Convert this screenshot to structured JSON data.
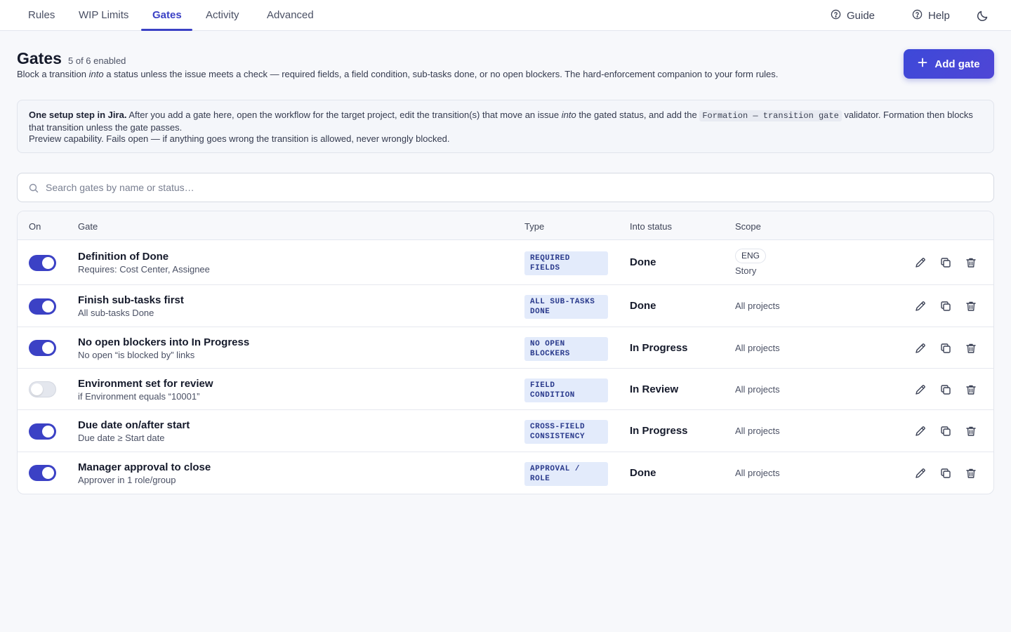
{
  "nav": {
    "tabs": [
      {
        "label": "Rules"
      },
      {
        "label": "WIP Limits"
      },
      {
        "label": "Gates"
      },
      {
        "label": "Activity"
      },
      {
        "label": "Advanced"
      }
    ],
    "active_tab": "Gates",
    "guide_label": "Guide",
    "help_label": "Help",
    "icons": {
      "guide": "help-circle-icon",
      "help": "help-circle-icon",
      "theme": "moon-icon"
    }
  },
  "header": {
    "title": "Gates",
    "count": "5 of 6 enabled",
    "desc_before": "Block a transition ",
    "desc_em": "into",
    "desc_after": " a status unless the issue meets a check — required fields, a field condition, sub-tasks done, or no open blockers. The hard-enforcement companion to your form rules.",
    "add_button": "Add gate",
    "add_icon": "plus-icon"
  },
  "info": {
    "bold": "One setup step in Jira.",
    "text1": " After you add a gate here, open the workflow for the target project, edit the transition(s) that move an issue ",
    "em": "into",
    "text2": " the gated status, and add the ",
    "code": "Formation — transition gate",
    "text3": " validator. Formation then blocks that transition unless the gate passes.",
    "line2": "Preview capability. Fails open — if anything goes wrong the transition is allowed, never wrongly blocked."
  },
  "search": {
    "placeholder": "Search gates by name or status…",
    "value": ""
  },
  "table": {
    "columns": {
      "on": "On",
      "gate": "Gate",
      "type": "Type",
      "status": "Into status",
      "scope": "Scope"
    },
    "rows": [
      {
        "enabled": true,
        "name": "Definition of Done",
        "sub": "Requires: Cost Center, Assignee",
        "type": "REQUIRED FIELDS",
        "status": "Done",
        "scope_pill": "ENG",
        "scope": "Story"
      },
      {
        "enabled": true,
        "name": "Finish sub-tasks first",
        "sub": "All sub-tasks Done",
        "type": "ALL SUB-TASKS DONE",
        "status": "Done",
        "scope_pill": "",
        "scope": "All projects"
      },
      {
        "enabled": true,
        "name": "No open blockers into In Progress",
        "sub": "No open “is blocked by” links",
        "type": "NO OPEN BLOCKERS",
        "status": "In Progress",
        "scope_pill": "",
        "scope": "All projects"
      },
      {
        "enabled": false,
        "name": "Environment set for review",
        "sub": "if Environment equals “10001”",
        "type": "FIELD CONDITION",
        "status": "In Review",
        "scope_pill": "",
        "scope": "All projects"
      },
      {
        "enabled": true,
        "name": "Due date on/after start",
        "sub": "Due date ≥ Start date",
        "type": "CROSS-FIELD CONSISTENCY",
        "status": "In Progress",
        "scope_pill": "",
        "scope": "All projects"
      },
      {
        "enabled": true,
        "name": "Manager approval to close",
        "sub": "Approver in 1 role/group",
        "type": "APPROVAL / ROLE",
        "status": "Done",
        "scope_pill": "",
        "scope": "All projects"
      }
    ],
    "row_actions": [
      "pencil-icon",
      "copy-icon",
      "trash-icon"
    ]
  },
  "colors": {
    "accent": "#3b41c5",
    "badge_bg": "#e3ebfb",
    "badge_text": "#2a3a8c",
    "page_bg": "#f7f8fb"
  }
}
